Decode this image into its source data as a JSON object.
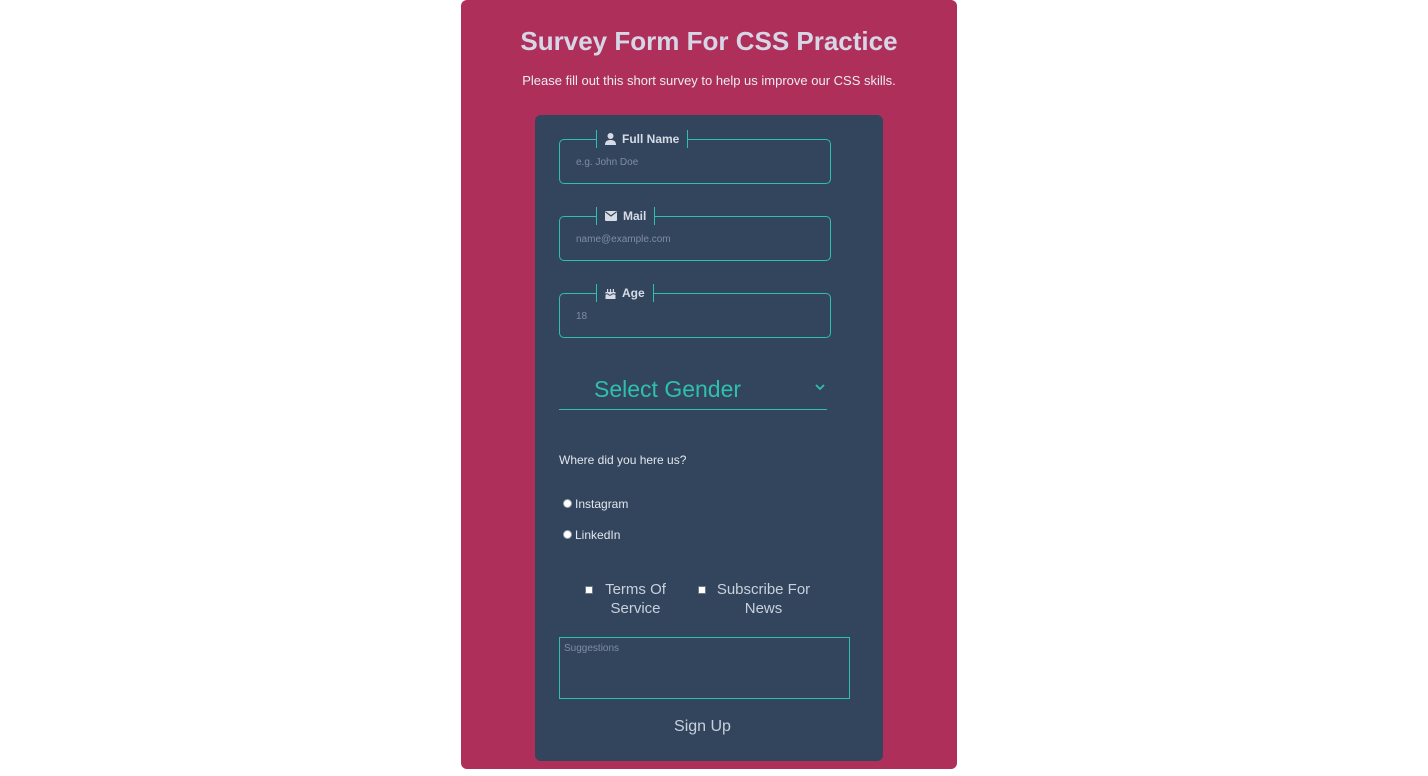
{
  "header": {
    "title": "Survey Form For CSS Practice",
    "subtitle": "Please fill out this short survey to help us improve our CSS skills."
  },
  "form": {
    "full_name": {
      "label": "Full Name",
      "icon": "user-icon",
      "placeholder": "e.g. John Doe"
    },
    "mail": {
      "label": "Mail",
      "icon": "envelope-icon",
      "placeholder": "name@example.com"
    },
    "age": {
      "label": "Age",
      "icon": "birthday-cake-icon",
      "placeholder": "18"
    },
    "gender": {
      "selected": "Select Gender",
      "icon": "chevron-down-icon"
    },
    "source_question": "Where did you here us?",
    "source_options": [
      "Instagram",
      "LinkedIn"
    ],
    "checkboxes": {
      "terms": "Terms Of Service",
      "news": "Subscribe For News"
    },
    "suggestions_placeholder": "Suggestions",
    "submit_label": "Sign Up"
  },
  "colors": {
    "page_bg": "#ffffff",
    "outer_bg": "#ae2f5a",
    "card_bg": "#33455d",
    "accent": "#2fbfad",
    "title_text": "#d6d6e6"
  }
}
